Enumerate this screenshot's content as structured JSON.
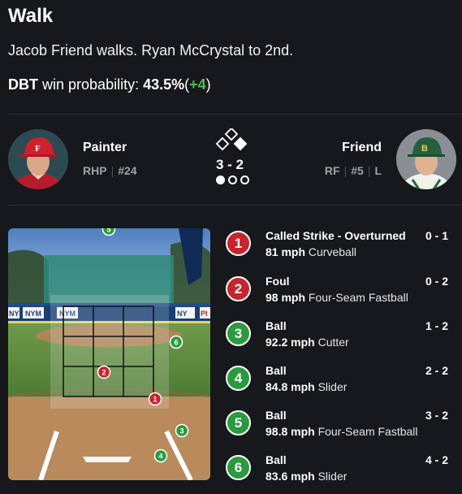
{
  "play": {
    "title": "Walk",
    "description": "Jacob Friend walks. Ryan McCrystal to 2nd."
  },
  "win_probability": {
    "team": "DBT",
    "label": "win probability:",
    "value": "43.5%",
    "open_paren": "(",
    "change": "+4",
    "close_paren": ")"
  },
  "pitcher": {
    "name": "Painter",
    "role": "RHP",
    "number": "#24"
  },
  "batter": {
    "name": "Friend",
    "position": "RF",
    "number": "#5",
    "bats": "L"
  },
  "game_state": {
    "count": "3 - 2",
    "runners_on": [
      "second"
    ],
    "outs": 1
  },
  "pitches": [
    {
      "n": "1",
      "type": "strike",
      "result": "Called Strike - Overturned",
      "count": "0 - 1",
      "speed": "81 mph",
      "pitch": "Curveball"
    },
    {
      "n": "2",
      "type": "strike",
      "result": "Foul",
      "count": "0 - 2",
      "speed": "98 mph",
      "pitch": "Four-Seam Fastball"
    },
    {
      "n": "3",
      "type": "ball",
      "result": "Ball",
      "count": "1 - 2",
      "speed": "92.2 mph",
      "pitch": "Cutter"
    },
    {
      "n": "4",
      "type": "ball",
      "result": "Ball",
      "count": "2 - 2",
      "speed": "84.8 mph",
      "pitch": "Slider"
    },
    {
      "n": "5",
      "type": "ball",
      "result": "Ball",
      "count": "3 - 2",
      "speed": "98.8 mph",
      "pitch": "Four-Seam Fastball"
    },
    {
      "n": "6",
      "type": "ball",
      "result": "Ball",
      "count": "4 - 2",
      "speed": "83.6 mph",
      "pitch": "Slider"
    }
  ],
  "zone": {
    "signage": [
      "NYM",
      "NYM",
      "NYM",
      "NY",
      "PI"
    ]
  },
  "colors": {
    "strike": "#c8242d",
    "ball": "#2b9a3e",
    "positive_change": "#4cbd5b"
  }
}
